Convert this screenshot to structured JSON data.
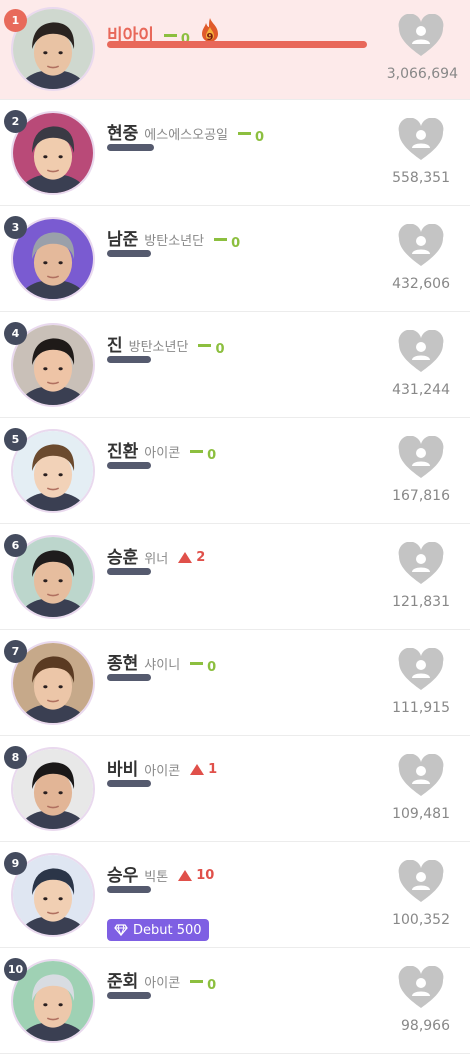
{
  "colors": {
    "first_row_bg": "#fdeaea",
    "first_accent": "#e8685a",
    "bar": "#555a6e",
    "same": "#8cbf3f",
    "up": "#e0504a",
    "badge": "#7e5fe3",
    "heart": "#c4c4c4"
  },
  "rankings": [
    {
      "rank": "1",
      "name": "비아이",
      "group": "",
      "change_type": "same",
      "change": "0",
      "fire": "9",
      "votes": "3,066,694",
      "bar_fraction": 1.0
    },
    {
      "rank": "2",
      "name": "현중",
      "group": "에스에스오공일",
      "change_type": "same",
      "change": "0",
      "votes": "558,351",
      "bar_fraction": 0.182
    },
    {
      "rank": "3",
      "name": "남준",
      "group": "방탄소년단",
      "change_type": "same",
      "change": "0",
      "votes": "432,606",
      "bar_fraction": 0.141
    },
    {
      "rank": "4",
      "name": "진",
      "group": "방탄소년단",
      "change_type": "same",
      "change": "0",
      "votes": "431,244",
      "bar_fraction": 0.141
    },
    {
      "rank": "5",
      "name": "진환",
      "group": "아이콘",
      "change_type": "same",
      "change": "0",
      "votes": "167,816",
      "bar_fraction": 0.055
    },
    {
      "rank": "6",
      "name": "승훈",
      "group": "위너",
      "change_type": "up",
      "change": "2",
      "votes": "121,831",
      "bar_fraction": 0.04
    },
    {
      "rank": "7",
      "name": "종현",
      "group": "샤이니",
      "change_type": "same",
      "change": "0",
      "votes": "111,915",
      "bar_fraction": 0.036
    },
    {
      "rank": "8",
      "name": "바비",
      "group": "아이콘",
      "change_type": "up",
      "change": "1",
      "votes": "109,481",
      "bar_fraction": 0.036
    },
    {
      "rank": "9",
      "name": "승우",
      "group": "빅톤",
      "change_type": "up",
      "change": "10",
      "badge": "Debut 500",
      "votes": "100,352",
      "bar_fraction": 0.033
    },
    {
      "rank": "10",
      "name": "준회",
      "group": "아이콘",
      "change_type": "same",
      "change": "0",
      "votes": "98,966",
      "bar_fraction": 0.032
    }
  ]
}
